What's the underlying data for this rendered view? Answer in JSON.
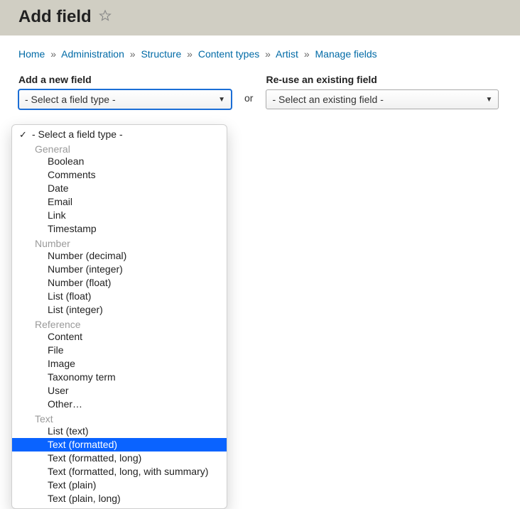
{
  "header": {
    "title": "Add field"
  },
  "breadcrumb": {
    "items": [
      {
        "label": "Home"
      },
      {
        "label": "Administration"
      },
      {
        "label": "Structure"
      },
      {
        "label": "Content types"
      },
      {
        "label": "Artist"
      },
      {
        "label": "Manage fields"
      }
    ],
    "separator": "»"
  },
  "add_new": {
    "label": "Add a new field",
    "selected": "- Select a field type -",
    "groups": [
      {
        "placeholder": {
          "label": "- Select a field type -",
          "checked": true
        }
      },
      {
        "name": "General",
        "options": [
          {
            "label": "Boolean"
          },
          {
            "label": "Comments"
          },
          {
            "label": "Date"
          },
          {
            "label": "Email"
          },
          {
            "label": "Link"
          },
          {
            "label": "Timestamp"
          }
        ]
      },
      {
        "name": "Number",
        "options": [
          {
            "label": "Number (decimal)"
          },
          {
            "label": "Number (integer)"
          },
          {
            "label": "Number (float)"
          },
          {
            "label": "List (float)"
          },
          {
            "label": "List (integer)"
          }
        ]
      },
      {
        "name": "Reference",
        "options": [
          {
            "label": "Content"
          },
          {
            "label": "File"
          },
          {
            "label": "Image"
          },
          {
            "label": "Taxonomy term"
          },
          {
            "label": "User"
          },
          {
            "label": "Other…"
          }
        ]
      },
      {
        "name": "Text",
        "options": [
          {
            "label": "List (text)"
          },
          {
            "label": "Text (formatted)",
            "highlight": true
          },
          {
            "label": "Text (formatted, long)"
          },
          {
            "label": "Text (formatted, long, with summary)"
          },
          {
            "label": "Text (plain)"
          },
          {
            "label": "Text (plain, long)"
          }
        ]
      }
    ]
  },
  "or_label": "or",
  "reuse": {
    "label": "Re-use an existing field",
    "selected": "- Select an existing field -"
  }
}
